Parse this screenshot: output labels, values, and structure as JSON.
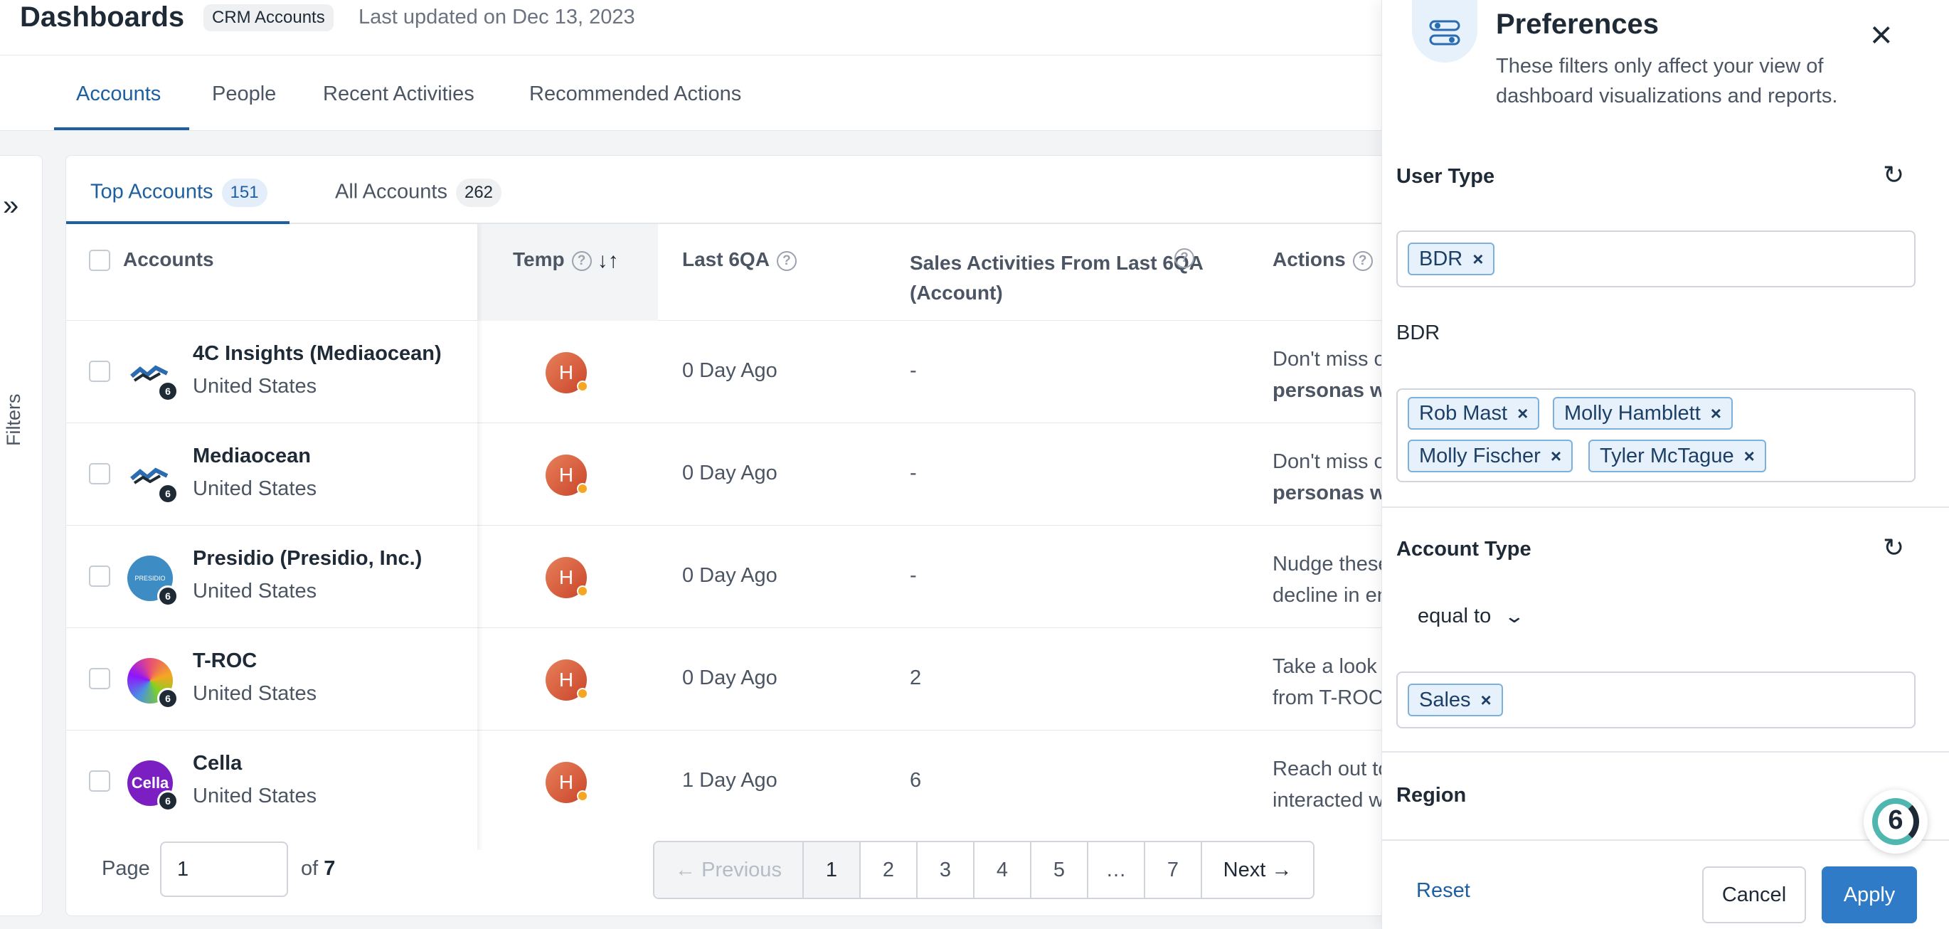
{
  "header": {
    "title": "Dashboards",
    "badge": "CRM Accounts",
    "updated": "Last updated on Dec 13, 2023"
  },
  "main_tabs": [
    {
      "label": "Accounts",
      "active": true
    },
    {
      "label": "People"
    },
    {
      "label": "Recent Activities"
    },
    {
      "label": "Recommended Actions"
    }
  ],
  "filters_label": "Filters",
  "sub_tabs": [
    {
      "label": "Top Accounts",
      "count": "151",
      "active": true
    },
    {
      "label": "All Accounts",
      "count": "262"
    }
  ],
  "columns": {
    "accounts": "Accounts",
    "temp": "Temp",
    "last6qa": "Last 6QA",
    "sales": "Sales Activities From Last 6QA (Account)",
    "actions": "Actions"
  },
  "rows": [
    {
      "name": "4C Insights (Mediaocean)",
      "country": "United States",
      "temp": "H",
      "last6qa": "0 Day Ago",
      "sales": "-",
      "action_line1": "Don't miss out",
      "action_line2": "personas who"
    },
    {
      "name": "Mediaocean",
      "country": "United States",
      "temp": "H",
      "last6qa": "0 Day Ago",
      "sales": "-",
      "action_line1": "Don't miss out",
      "action_line2": "personas who"
    },
    {
      "name": "Presidio (Presidio, Inc.)",
      "country": "United States",
      "temp": "H",
      "last6qa": "0 Day Ago",
      "sales": "-",
      "action_line1": "Nudge these",
      "action_line2": "decline in eng"
    },
    {
      "name": "T-ROC",
      "country": "United States",
      "temp": "H",
      "last6qa": "0 Day Ago",
      "sales": "2",
      "action_line1": "Take a look at",
      "action_line2": "from T-ROC"
    },
    {
      "name": "Cella",
      "country": "United States",
      "temp": "H",
      "last6qa": "1 Day Ago",
      "sales": "6",
      "action_line1": "Reach out to",
      "action_line2": "interacted with"
    }
  ],
  "logos": {
    "presidio_text": "PRESIDIO",
    "cella_text": "Cella",
    "mini_badge": "6"
  },
  "pagination": {
    "page_label": "Page",
    "current": "1",
    "of_label": "of",
    "total": "7",
    "previous": "Previous",
    "pages": [
      "1",
      "2",
      "3",
      "4",
      "5",
      "…",
      "7"
    ],
    "next": "Next"
  },
  "preferences": {
    "title": "Preferences",
    "description": "These filters only affect your view of dashboard visualizations and reports.",
    "user_type_title": "User Type",
    "user_type_tag": "BDR",
    "user_type_sub": "BDR",
    "users": [
      "Rob Mast",
      "Molly Hamblett",
      "Molly Fischer",
      "Tyler McTague"
    ],
    "account_type_title": "Account Type",
    "operator": "equal to",
    "account_type_tag": "Sales",
    "region_title": "Region",
    "reset": "Reset",
    "cancel": "Cancel",
    "apply": "Apply"
  },
  "colors": {
    "accent": "#1d5fa0",
    "apply_button": "#2f7bc8",
    "tag_bg": "#e6f1fb",
    "tag_border": "#7cb1dd",
    "temp_hot": "#d9603d"
  },
  "icons": {
    "close": "close-icon",
    "refresh": "refresh-icon",
    "sort": "sort-icon",
    "help": "help-icon",
    "expand": "double-chevron-right-icon",
    "preferences": "sliders-icon"
  }
}
